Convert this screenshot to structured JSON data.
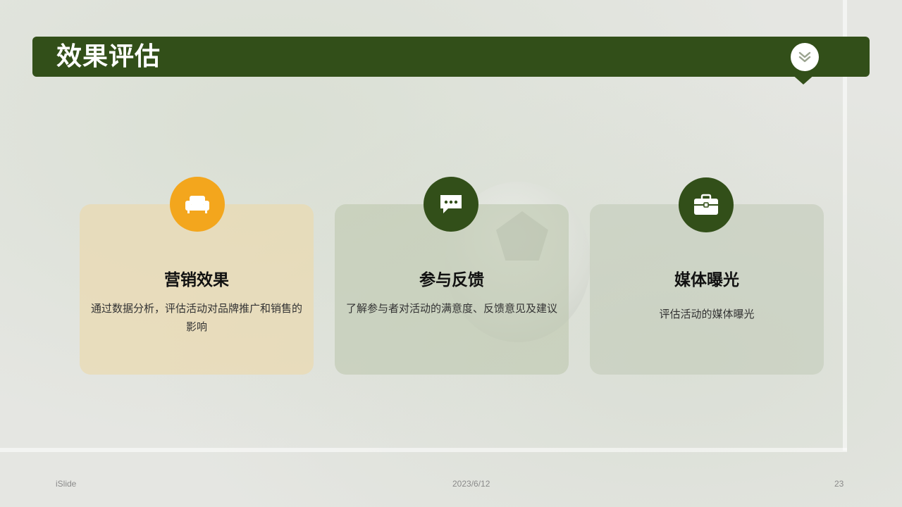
{
  "slide": {
    "title": "效果评估",
    "title_badge_icon": "double-chevron-down-icon"
  },
  "cards": [
    {
      "title": "营销效果",
      "description": "通过数据分析，评估活动对品牌推广和销售的影响",
      "icon": "sofa-icon",
      "icon_color": "#f3a61d"
    },
    {
      "title": "参与反馈",
      "description": "了解参与者对活动的满意度、反馈意见及建议",
      "icon": "chat-bubble-icon",
      "icon_color": "#324f19"
    },
    {
      "title": "媒体曝光",
      "description": "评估活动的媒体曝光",
      "icon": "briefcase-icon",
      "icon_color": "#324f19"
    }
  ],
  "footer": {
    "brand": "iSlide",
    "date": "2023/6/12",
    "page_number": "23"
  },
  "colors": {
    "primary": "#324f19",
    "accent": "#f3a61d"
  }
}
